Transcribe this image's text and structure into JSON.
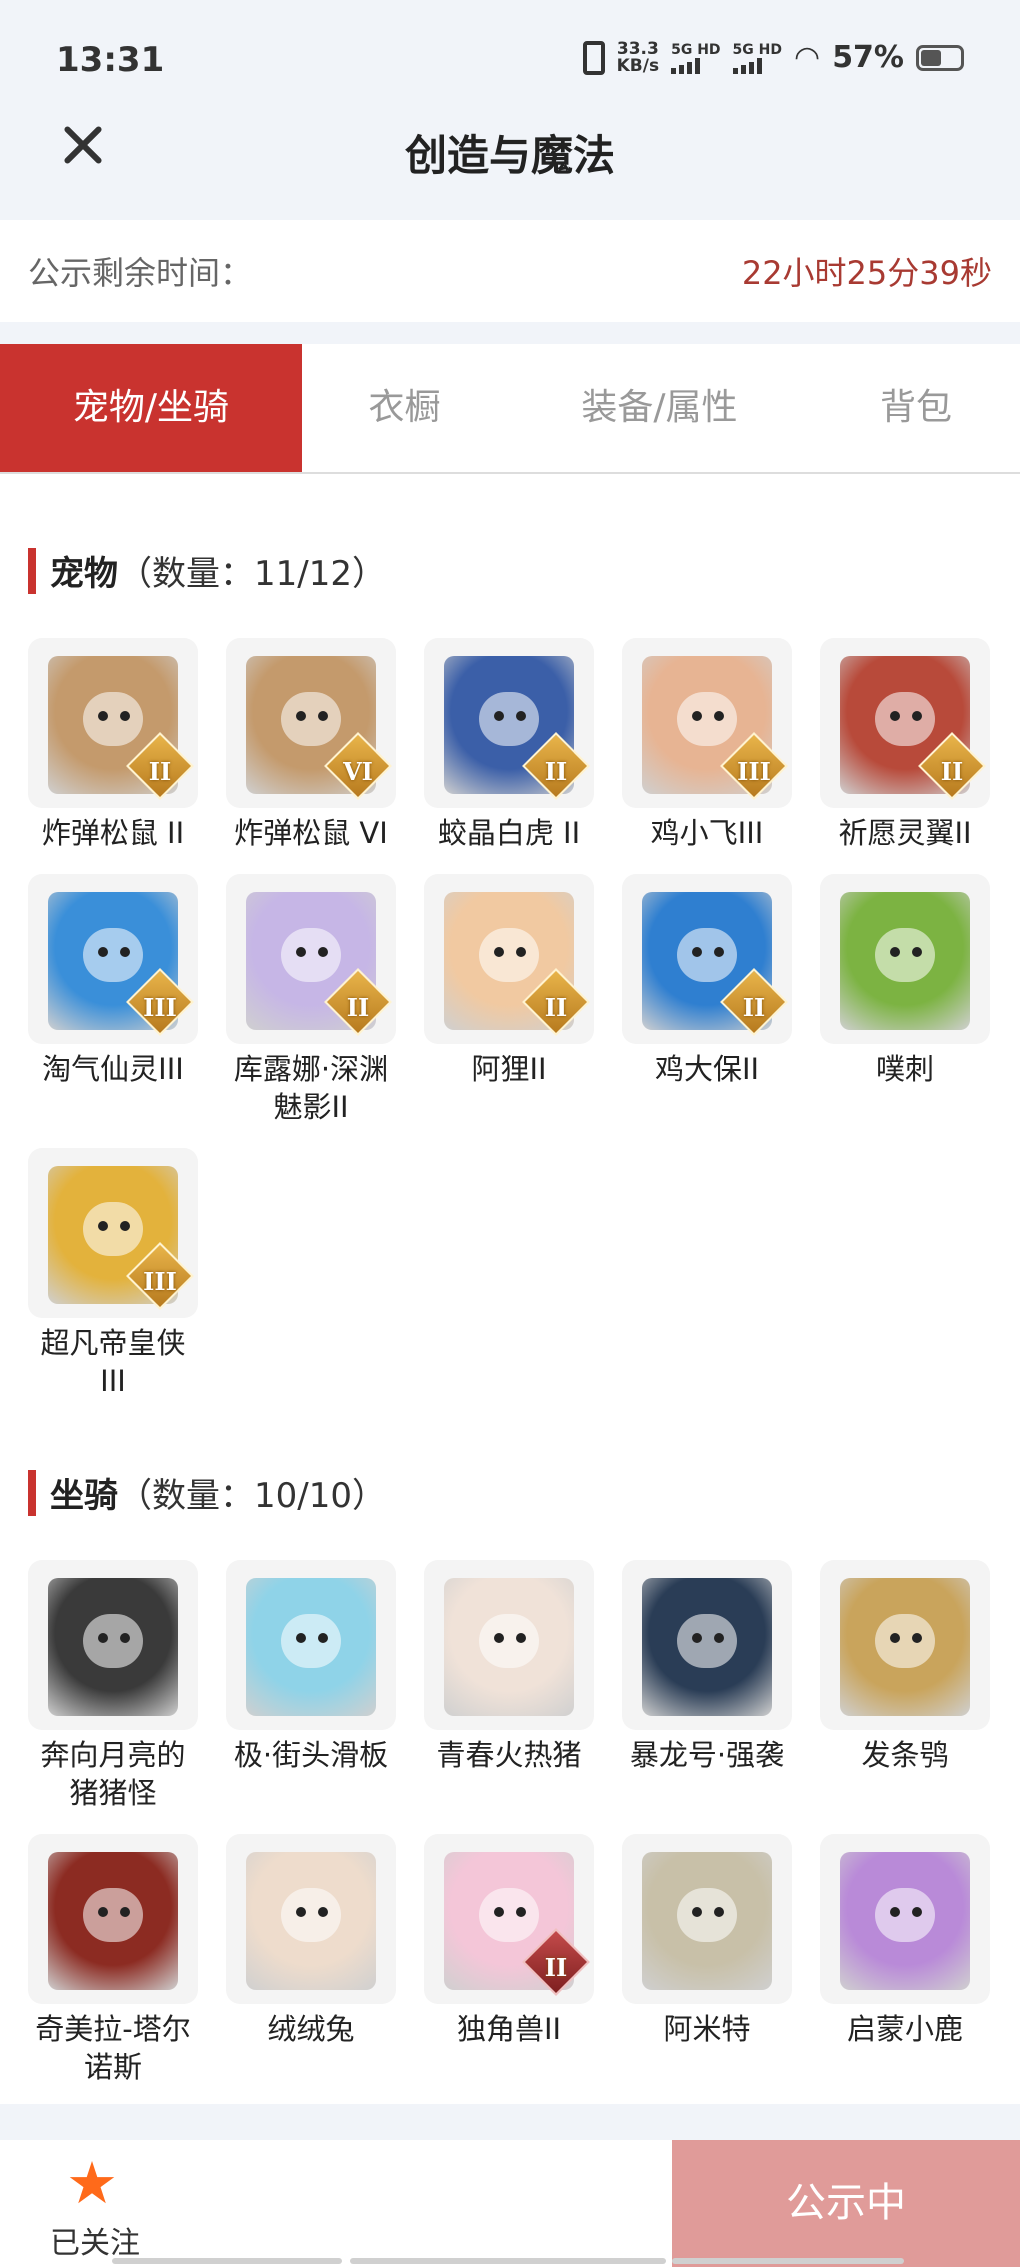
{
  "status_bar": {
    "time": "13:31",
    "speed_value": "33.3",
    "speed_unit": "KB/s",
    "net1": "5G HD",
    "net2": "5G HD",
    "battery": "57%"
  },
  "header": {
    "title": "创造与魔法"
  },
  "notice": {
    "label": "公示剩余时间：",
    "value": "22小时25分39秒"
  },
  "tabs": [
    {
      "label": "宠物/坐骑"
    },
    {
      "label": "衣橱"
    },
    {
      "label": "装备/属性"
    },
    {
      "label": "背包"
    }
  ],
  "pets": {
    "title": "宠物",
    "count": "（数量：11/12）",
    "items": [
      {
        "name": "炸弹松鼠 II",
        "badge": "II",
        "color": "#c49a6c"
      },
      {
        "name": "炸弹松鼠 VI",
        "badge": "VI",
        "color": "#c49a6c"
      },
      {
        "name": "蛟晶白虎 II",
        "badge": "II",
        "color": "#3b5fa8"
      },
      {
        "name": "鸡小飞III",
        "badge": "III",
        "color": "#e7b493"
      },
      {
        "name": "祈愿灵翼II",
        "badge": "II",
        "color": "#b84a3a"
      },
      {
        "name": "淘气仙灵III",
        "badge": "III",
        "color": "#3a8fd9"
      },
      {
        "name": "库露娜·深渊魅影II",
        "badge": "II",
        "color": "#c6b6e6"
      },
      {
        "name": "阿狸II",
        "badge": "II",
        "color": "#f1c9a1"
      },
      {
        "name": "鸡大保II",
        "badge": "II",
        "color": "#2f7fd0"
      },
      {
        "name": "噗刺",
        "badge": "",
        "color": "#7cb342"
      },
      {
        "name": "超凡帝皇侠III",
        "badge": "III",
        "color": "#e3b23c"
      }
    ]
  },
  "mounts": {
    "title": "坐骑",
    "count": "（数量：10/10）",
    "items": [
      {
        "name": "奔向月亮的猪猪怪",
        "badge": "",
        "color": "#3a3a3a"
      },
      {
        "name": "极·街头滑板",
        "badge": "",
        "color": "#8fd3e8"
      },
      {
        "name": "青春火热猪",
        "badge": "",
        "color": "#f0e2d8"
      },
      {
        "name": "暴龙号·强袭",
        "badge": "",
        "color": "#2a3d56"
      },
      {
        "name": "发条鸮",
        "badge": "",
        "color": "#c9a45c"
      },
      {
        "name": "奇美拉-塔尔诺斯",
        "badge": "",
        "color": "#8c2b22"
      },
      {
        "name": "绒绒兔",
        "badge": "",
        "color": "#eedccc"
      },
      {
        "name": "独角兽II",
        "badge": "II",
        "color": "#f4c6d8"
      },
      {
        "name": "阿米特",
        "badge": "",
        "color": "#c8c0a8"
      },
      {
        "name": "启蒙小鹿",
        "badge": "",
        "color": "#b98ad8"
      }
    ]
  },
  "bottom_bar": {
    "follow_label": "已关注",
    "status_label": "公示中"
  },
  "colors": {
    "accent": "#c9332f",
    "countdown": "#a83a32",
    "star": "#ff6a1a",
    "status_button": "#e09b99"
  },
  "icons": {
    "close": "close-icon",
    "star": "star-icon"
  }
}
